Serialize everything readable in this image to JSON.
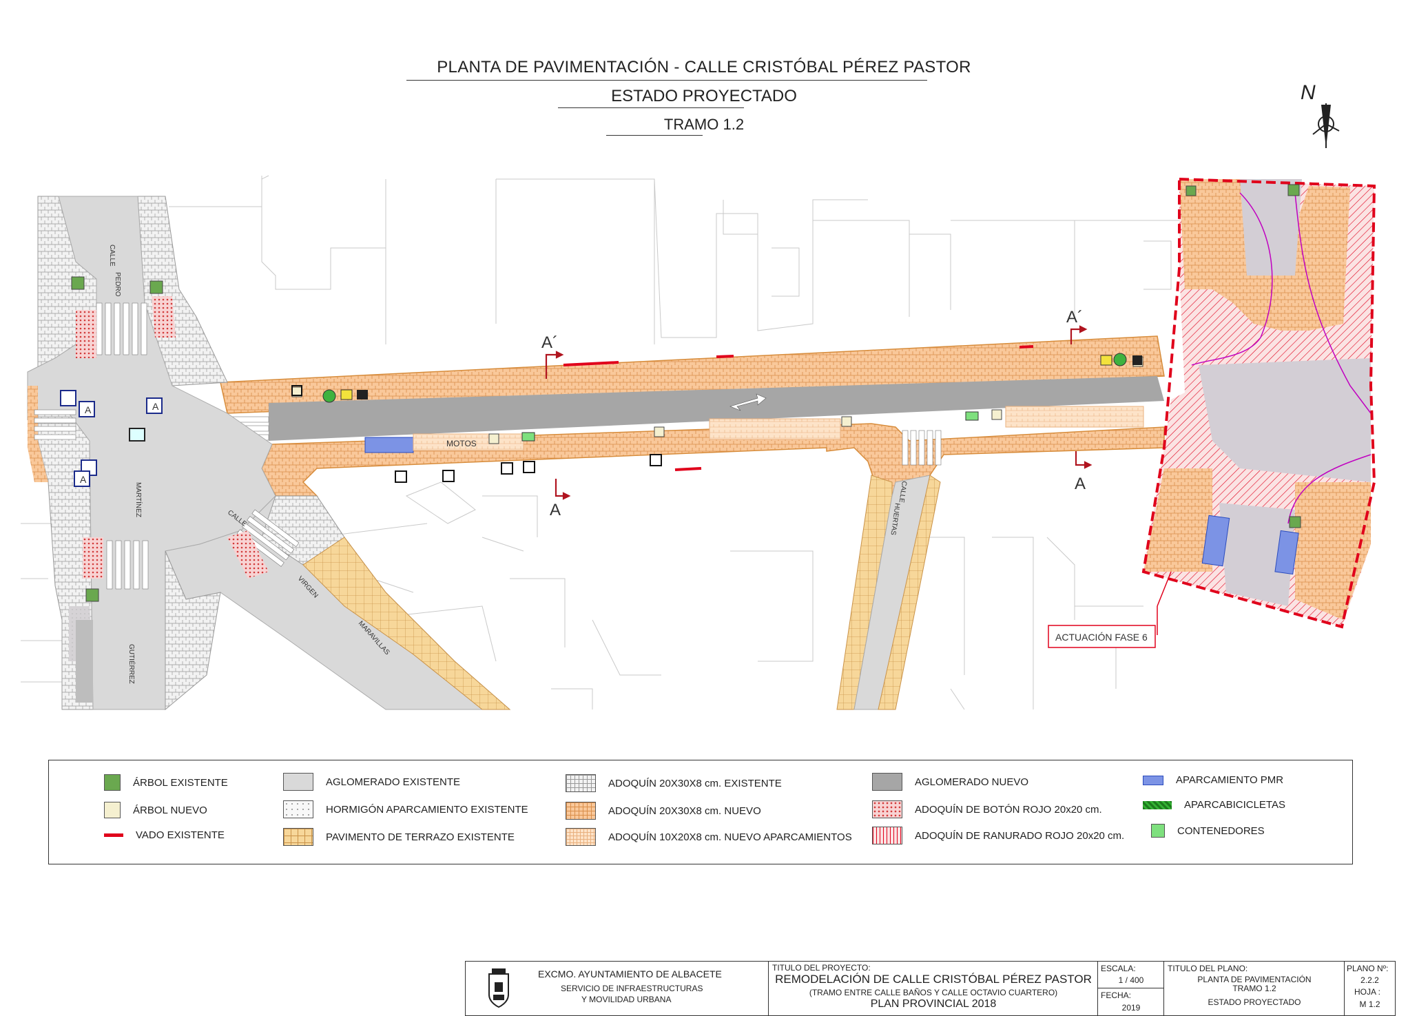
{
  "title": {
    "line1": "PLANTA DE PAVIMENTACIÓN - CALLE  CRISTÓBAL  PÉREZ  PASTOR",
    "line2": "ESTADO PROYECTADO",
    "line3": "TRAMO 1.2"
  },
  "north_label": "N",
  "map": {
    "street_labels": [
      "CALLE",
      "PEDRO",
      "MARTÍNEZ",
      "GUTIÉRREZ",
      "CALLE",
      "VIRGEN",
      "MARAVILLAS",
      "CALLE",
      "HUERTAS"
    ],
    "motos_label": "MOTOS",
    "section_top_left": "A´",
    "section_bottom_left": "A",
    "section_top_right": "A´",
    "section_bottom_right": "A",
    "phase_label": "ACTUACIÓN FASE 6",
    "parking_sign": "A"
  },
  "legend": {
    "items": [
      {
        "label": "ÁRBOL  EXISTENTE",
        "swatch": "tree-existing"
      },
      {
        "label": "ÁRBOL  NUEVO",
        "swatch": "tree-new"
      },
      {
        "label": "VADO  EXISTENTE",
        "swatch": "vado"
      },
      {
        "label": "AGLOMERADO   EXISTENTE",
        "swatch": "aglo-existing"
      },
      {
        "label": "HORMIGÓN APARCAMIENTO EXISTENTE",
        "swatch": "hormigon"
      },
      {
        "label": "PAVIMENTO DE TERRAZO  EXISTENTE",
        "swatch": "terrazo"
      },
      {
        "label": "ADOQUÍN 20X30X8 cm.  EXISTENTE",
        "swatch": "adoq-existing"
      },
      {
        "label": "ADOQUÍN 20X30X8 cm. NUEVO",
        "swatch": "adoq-new"
      },
      {
        "label": "ADOQUÍN  10X20X8 cm. NUEVO APARCAMIENTOS",
        "swatch": "adoq-park"
      },
      {
        "label": "AGLOMERADO    NUEVO",
        "swatch": "aglo-new"
      },
      {
        "label": "ADOQUÍN DE BOTÓN ROJO 20x20 cm.",
        "swatch": "boton"
      },
      {
        "label": "ADOQUÍN DE RANURADO ROJO 20x20 cm.",
        "swatch": "ranurado"
      },
      {
        "label": "APARCAMIENTO PMR",
        "swatch": "pmr"
      },
      {
        "label": "APARCABICICLETAS",
        "swatch": "bici"
      },
      {
        "label": "CONTENEDORES",
        "swatch": "contenedores"
      }
    ]
  },
  "cartouche": {
    "org_name": "EXCMO. AYUNTAMIENTO DE ALBACETE",
    "org_service1": "SERVICIO DE INFRAESTRUCTURAS",
    "org_service2": "Y MOVILIDAD URBANA",
    "project_heading": "TITULO DEL PROYECTO:",
    "project_title": "REMODELACIÓN DE CALLE  CRISTÓBAL  PÉREZ  PASTOR",
    "project_sub": "(TRAMO ENTRE CALLE BAÑOS Y CALLE OCTAVIO CUARTERO)",
    "project_plan": "PLAN PROVINCIAL 2018",
    "scale_heading": "ESCALA:",
    "scale_value": "1 / 400",
    "date_heading": "FECHA:",
    "date_value": "2019",
    "plan_heading": "TITULO DEL PLANO:",
    "plan_title1": "PLANTA  DE PAVIMENTACIÓN",
    "plan_title2": "TRAMO 1.2",
    "plan_title3": "ESTADO PROYECTADO",
    "plano_heading": "PLANO Nº:",
    "plano_value": "2.2.2",
    "hoja_heading": "HOJA :",
    "hoja_value": "M 1.2"
  },
  "colors": {
    "adoquin_nuevo": "#f9c89a",
    "aglomerado_nuevo": "#a6a6a6",
    "aglomerado_existente": "#d9d9d9",
    "rojo": "#e0001b",
    "terrazo": "#f7d79a"
  }
}
